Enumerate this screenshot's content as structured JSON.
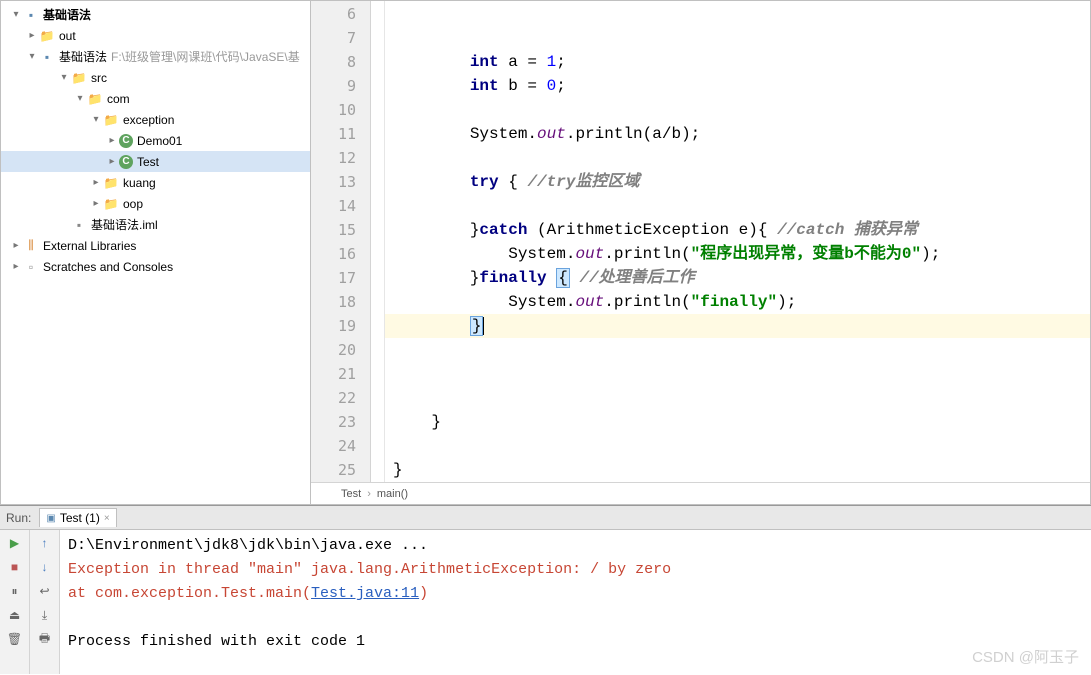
{
  "tree": {
    "root": "基础语法",
    "out": "out",
    "module": "基础语法",
    "module_path": "F:\\班级管理\\网课班\\代码\\JavaSE\\基",
    "src": "src",
    "com": "com",
    "exception": "exception",
    "demo01": "Demo01",
    "test": "Test",
    "kuang": "kuang",
    "oop": "oop",
    "iml": "基础语法.iml",
    "ext_lib": "External Libraries",
    "scratches": "Scratches and Consoles"
  },
  "gutter": [
    "6",
    "7",
    "8",
    "9",
    "10",
    "11",
    "12",
    "13",
    "14",
    "15",
    "16",
    "17",
    "18",
    "19",
    "20",
    "21",
    "22",
    "23",
    "24",
    "25"
  ],
  "code": {
    "l8": {
      "kw1": "int",
      "v": " a = ",
      "n": "1",
      "e": ";"
    },
    "l9": {
      "kw1": "int",
      "v": " b = ",
      "n": "0",
      "e": ";"
    },
    "l11": {
      "s": "System.",
      "out": "out",
      "p": ".println(a/b);"
    },
    "l13": {
      "kw": "try",
      "b": " { ",
      "c": "//try监控区域"
    },
    "l15": {
      "b": "}",
      "kw": "catch",
      "p": " (ArithmeticException e){ ",
      "c": "//catch 捕获异常"
    },
    "l16": {
      "pad": "    System.",
      "out": "out",
      "p": ".println(",
      "str": "\"程序出现异常，变量b不能为0\"",
      "e": ");"
    },
    "l17": {
      "b": "}",
      "kw": "finally",
      "sp": " ",
      "brace": "{",
      "sp2": " ",
      "c": "//处理善后工作"
    },
    "l18": {
      "pad": "    System.",
      "out": "out",
      "p": ".println(",
      "str": "\"finally\"",
      "e": ");"
    },
    "l19": {
      "brace": "}"
    },
    "l23": "    }",
    "l25": "}"
  },
  "breadcrumb": {
    "a": "Test",
    "b": "main()"
  },
  "run": {
    "label": "Run:",
    "tab": "Test (1)",
    "line1": "D:\\Environment\\jdk8\\jdk\\bin\\java.exe ...",
    "line2": "Exception in thread \"main\" java.lang.ArithmeticException: / by zero",
    "line3a": "    at com.exception.Test.main(",
    "line3link": "Test.java:11",
    "line3b": ")",
    "line5": "Process finished with exit code 1"
  },
  "watermark": "CSDN @阿玉子",
  "chart_data": null
}
